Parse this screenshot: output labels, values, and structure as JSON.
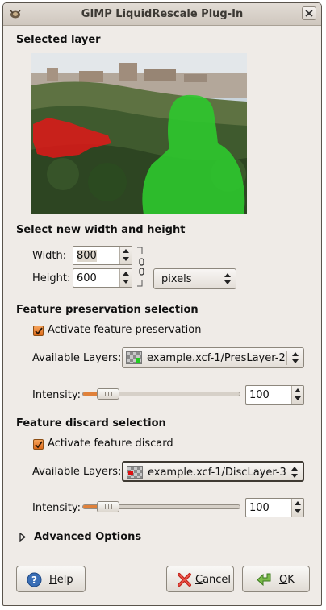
{
  "window": {
    "title": "GIMP LiquidRescale Plug-In"
  },
  "selected_layer": {
    "heading": "Selected layer"
  },
  "size": {
    "heading": "Select new width and height",
    "width_label": "Width:",
    "width_value": "800",
    "height_label": "Height:",
    "height_value": "600",
    "unit": "pixels"
  },
  "preservation": {
    "heading": "Feature preservation selection",
    "checkbox_label": "Activate feature preservation",
    "checked": true,
    "layers_label": "Available Layers:",
    "layer_value": "example.xcf-1/PresLayer-2",
    "intensity_label": "Intensity:",
    "intensity_value": "100"
  },
  "discard": {
    "heading": "Feature discard selection",
    "checkbox_label": "Activate feature discard",
    "checked": true,
    "layers_label": "Available Layers:",
    "layer_value": "example.xcf-1/DiscLayer-3",
    "intensity_label": "Intensity:",
    "intensity_value": "100"
  },
  "advanced": {
    "label": "Advanced Options"
  },
  "buttons": {
    "help": "Help",
    "cancel": "Cancel",
    "ok": "OK"
  },
  "colors": {
    "accent": "#e0813a",
    "preserve_mask": "#2ec82e",
    "discard_mask": "#e01818"
  }
}
